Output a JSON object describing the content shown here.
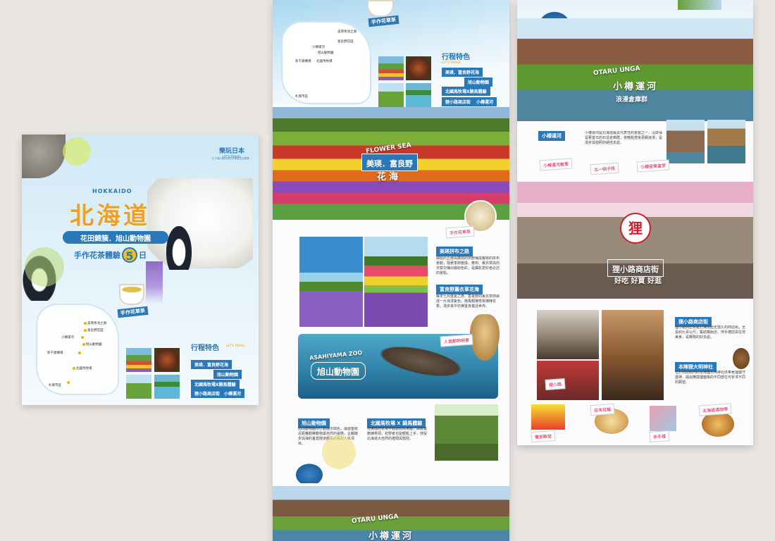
{
  "sheet1": {
    "brand": "樂玩日本",
    "brand_en": "LET'S TRAVEL",
    "brand_sub": "以下僅介紹日本的日常及生活習慣",
    "region_en": "HOKKAIDO",
    "title": "北海道",
    "subtitle": "花田錦簇．旭山動物園",
    "tagline_a": "手作花茶體驗",
    "days": "5",
    "tagline_b": "日",
    "tea_label": "手作花草茶",
    "features_title": "行程特色",
    "features_en": "LET'S TRAVEL",
    "features": [
      "美瑛．富良野花海",
      "旭山動物園",
      "北國馬牧場X騎馬體驗",
      "狸小路商店街",
      "小樽運河"
    ],
    "map_labels": [
      "美瑛青池之湖",
      "富良野花田",
      "小樽運河",
      "旭山動物園",
      "新千歲機場",
      "北國馬牧場",
      "札幌市區"
    ]
  },
  "sheet2": {
    "tea_label": "手作花草茶",
    "features_title": "行程特色",
    "features_en": "LET'S TRAVEL",
    "features": [
      "美瑛．富良野花海",
      "旭山動物園",
      "北國馬牧場X騎馬體驗",
      "狸小路商店街",
      "小樽運河"
    ],
    "map_labels": [
      "美瑛青池之湖",
      "富良野花田",
      "小樽運河",
      "旭山動物園",
      "新千歲機場",
      "北國馬牧場",
      "札幌市區"
    ],
    "flower_en": "FLOWER SEA",
    "flower_title": "美瑛．富良野",
    "flower_sub": "花海",
    "sticker_tea": "手作花草茶",
    "biei_title": "美瑛拼布之路",
    "biei_text": "綿延的丘陵與廣闊的田野構成獨特的拼布景觀，隨著季節變換，麥田、薰衣草與向日葵交織出繽紛色彩，是攝影愛好者必訪的景點。",
    "furano_title": "富良野薰衣草花海",
    "furano_text": "每年七月盛夏之際，富良野的薰衣草田染成一片浪漫紫色，微風輕拂帶來陣陣花香，漫步其中彷彿置身童話世界。",
    "zoo_en": "ASAHIYAMA ZOO",
    "zoo_title": "旭山動物園",
    "zoo_sticker": "人氣動物明星",
    "zoo_tag": "旭山動物園",
    "zoo_text": "旭山動物園以行動展示聞名，讓遊客能近距離觀察動物最自然的姿態，企鵝散步與海豹垂直隧道都是必看的人氣項目。",
    "ranch_tag": "北國馬牧場 X 騎馬體驗",
    "ranch_text": "在廣闊的牧場中體驗騎馬樂趣，由專業教練帶領，初學者也能輕鬆上手，感受北海道大自然的遼闊與悠閒。",
    "otaru_en": "OTARU UNGA",
    "otaru_title": "小樽運河"
  },
  "sheet3": {
    "otaru_en": "OTARU UNGA",
    "otaru_title": "小樽運河",
    "otaru_sub": "浪漫倉庫群",
    "canal_tag": "小樽運河",
    "canal_text": "小樽運河是北海道最具代表性的景點之一，沿岸保留著昔日的石造倉庫群，夜晚點燈後更顯浪漫，是漫步與拍照的絕佳去處。",
    "canal_stickers": [
      "小樽運河散策",
      "北一硝子館",
      "小樽音樂盒堂"
    ],
    "shop_title": "狸小路商店街",
    "shop_sub": "好吃 好買 好逛",
    "shop_tag": "狸小路商店街",
    "shop_text": "狸小路商店街是北海道歷史悠久的商店街，全長約九百公尺，集結藥妝店、伴手禮店與在地美食，是購物的好去處。",
    "shrine_tag": "本陣狸大明神社",
    "shrine_text": "位於商店街內的本陣狸大明神社供奉著狸貓守護神，據說撫摸狸貓像的不同部位可祈求不同的願望。",
    "shop_stickers": [
      "狸小路",
      "驚安殿堂",
      "日本拉麵",
      "伴手禮",
      "北海道湯咖哩"
    ]
  },
  "colors": {
    "accent_blue": "#2a78b8",
    "accent_yellow": "#e8b400",
    "accent_pink": "#d0407a",
    "title_orange": "#f0a020"
  }
}
